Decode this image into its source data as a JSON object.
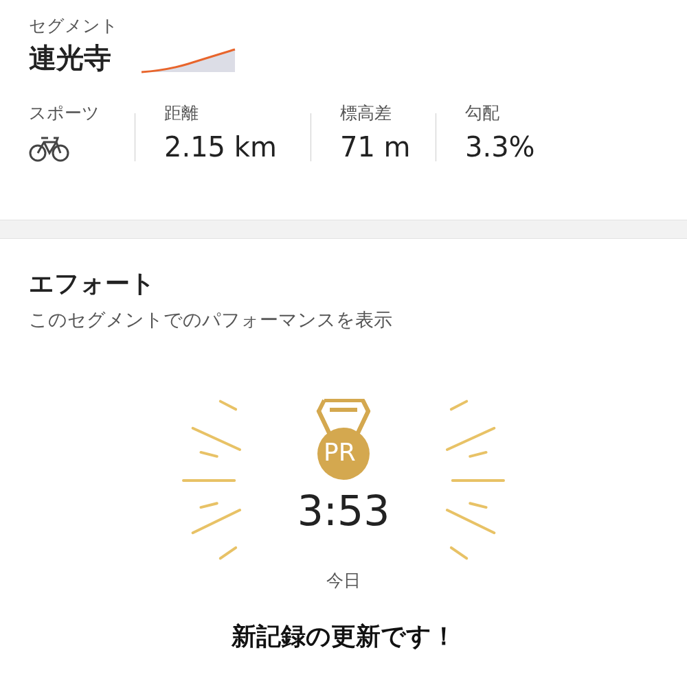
{
  "segment": {
    "label": "セグメント",
    "name": "連光寺"
  },
  "stats": [
    {
      "kind": "sport",
      "label": "スポーツ"
    },
    {
      "kind": "value",
      "label": "距離",
      "value": "2.15 km"
    },
    {
      "kind": "value",
      "label": "標高差",
      "value": "71 m"
    },
    {
      "kind": "value",
      "label": "勾配",
      "value": "3.3%"
    }
  ],
  "efforts": {
    "title": "エフォート",
    "subtitle": "このセグメントでのパフォーマンスを表示",
    "badge": "PR",
    "time": "3:53",
    "date": "今日",
    "message": "新記録の更新です！"
  }
}
